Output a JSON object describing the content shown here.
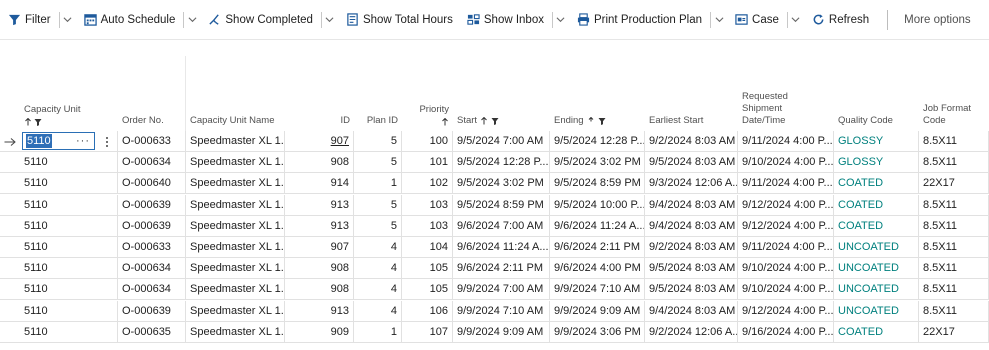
{
  "toolbar": {
    "items": [
      {
        "label": "Filter",
        "icon": "filter-icon",
        "caret": true
      },
      {
        "label": "Auto Schedule",
        "icon": "calendar-icon",
        "caret": true
      },
      {
        "label": "Show Completed",
        "icon": "show-completed-icon",
        "caret": true
      },
      {
        "label": "Show Total Hours",
        "icon": "total-hours-icon",
        "caret": false
      },
      {
        "label": "Show Inbox",
        "icon": "inbox-icon",
        "caret": true
      },
      {
        "label": "Print Production Plan",
        "icon": "print-icon",
        "caret": true
      },
      {
        "label": "Case",
        "icon": "case-icon",
        "caret": true
      },
      {
        "label": "Refresh",
        "icon": "refresh-icon",
        "caret": false
      }
    ],
    "more_options": "More options"
  },
  "columns": {
    "capacity_unit": "Capacity Unit",
    "order_no": "Order No.",
    "capacity_unit_name": "Capacity Unit Name",
    "id": "ID",
    "plan_id": "Plan ID",
    "priority": "Priority",
    "start": "Start",
    "ending": "Ending",
    "earliest_start": "Earliest Start",
    "requested_shipment_l1": "Requested",
    "requested_shipment_l2": "Shipment",
    "requested_shipment_l3": "Date/Time",
    "quality_code": "Quality Code",
    "job_format_l1": "Job Format",
    "job_format_l2": "Code"
  },
  "edit_value": "5110",
  "edit_ellipsis": "···",
  "rows": [
    {
      "unit": "5110",
      "order": "O-000633",
      "name": "Speedmaster XL 1...",
      "id": "907",
      "plan": "5",
      "priority": "100",
      "start": "9/5/2024 7:00 AM",
      "ending": "9/5/2024 12:28 P...",
      "earliest": "9/2/2024 8:03 AM",
      "requested": "9/11/2024 4:00 P...",
      "quality": "GLOSSY",
      "format": "8.5X11"
    },
    {
      "unit": "5110",
      "order": "O-000634",
      "name": "Speedmaster XL 1...",
      "id": "908",
      "plan": "5",
      "priority": "101",
      "start": "9/5/2024 12:28 P...",
      "ending": "9/5/2024 3:02 PM",
      "earliest": "9/5/2024 8:03 AM",
      "requested": "9/10/2024 4:00 P...",
      "quality": "GLOSSY",
      "format": "8.5X11"
    },
    {
      "unit": "5110",
      "order": "O-000640",
      "name": "Speedmaster XL 1...",
      "id": "914",
      "plan": "1",
      "priority": "102",
      "start": "9/5/2024 3:02 PM",
      "ending": "9/5/2024 8:59 PM",
      "earliest": "9/3/2024 12:06 A...",
      "requested": "9/11/2024 4:00 P...",
      "quality": "COATED",
      "format": "22X17"
    },
    {
      "unit": "5110",
      "order": "O-000639",
      "name": "Speedmaster XL 1...",
      "id": "913",
      "plan": "5",
      "priority": "103",
      "start": "9/5/2024 8:59 PM",
      "ending": "9/5/2024 10:00 P...",
      "earliest": "9/4/2024 8:03 AM",
      "requested": "9/12/2024 4:00 P...",
      "quality": "COATED",
      "format": "8.5X11"
    },
    {
      "unit": "5110",
      "order": "O-000639",
      "name": "Speedmaster XL 1...",
      "id": "913",
      "plan": "5",
      "priority": "103",
      "start": "9/6/2024 7:00 AM",
      "ending": "9/6/2024 11:24 A...",
      "earliest": "9/4/2024 8:03 AM",
      "requested": "9/12/2024 4:00 P...",
      "quality": "COATED",
      "format": "8.5X11"
    },
    {
      "unit": "5110",
      "order": "O-000633",
      "name": "Speedmaster XL 1...",
      "id": "907",
      "plan": "4",
      "priority": "104",
      "start": "9/6/2024 11:24 A...",
      "ending": "9/6/2024 2:11 PM",
      "earliest": "9/2/2024 8:03 AM",
      "requested": "9/11/2024 4:00 P...",
      "quality": "UNCOATED",
      "format": "8.5X11"
    },
    {
      "unit": "5110",
      "order": "O-000634",
      "name": "Speedmaster XL 1...",
      "id": "908",
      "plan": "4",
      "priority": "105",
      "start": "9/6/2024 2:11 PM",
      "ending": "9/6/2024 4:00 PM",
      "earliest": "9/5/2024 8:03 AM",
      "requested": "9/10/2024 4:00 P...",
      "quality": "UNCOATED",
      "format": "8.5X11"
    },
    {
      "unit": "5110",
      "order": "O-000634",
      "name": "Speedmaster XL 1...",
      "id": "908",
      "plan": "4",
      "priority": "105",
      "start": "9/9/2024 7:00 AM",
      "ending": "9/9/2024 7:10 AM",
      "earliest": "9/5/2024 8:03 AM",
      "requested": "9/10/2024 4:00 P...",
      "quality": "UNCOATED",
      "format": "8.5X11"
    },
    {
      "unit": "5110",
      "order": "O-000639",
      "name": "Speedmaster XL 1...",
      "id": "913",
      "plan": "4",
      "priority": "106",
      "start": "9/9/2024 7:10 AM",
      "ending": "9/9/2024 9:09 AM",
      "earliest": "9/4/2024 8:03 AM",
      "requested": "9/12/2024 4:00 P...",
      "quality": "UNCOATED",
      "format": "8.5X11"
    },
    {
      "unit": "5110",
      "order": "O-000635",
      "name": "Speedmaster XL 1...",
      "id": "909",
      "plan": "1",
      "priority": "107",
      "start": "9/9/2024 9:09 AM",
      "ending": "9/9/2024 3:06 PM",
      "earliest": "9/2/2024 12:06 A...",
      "requested": "9/16/2024 4:00 P...",
      "quality": "COATED",
      "format": "22X17"
    }
  ],
  "colors": {
    "link": "#00807e",
    "accent": "#2f6fb7",
    "border": "#e1e1e1"
  }
}
